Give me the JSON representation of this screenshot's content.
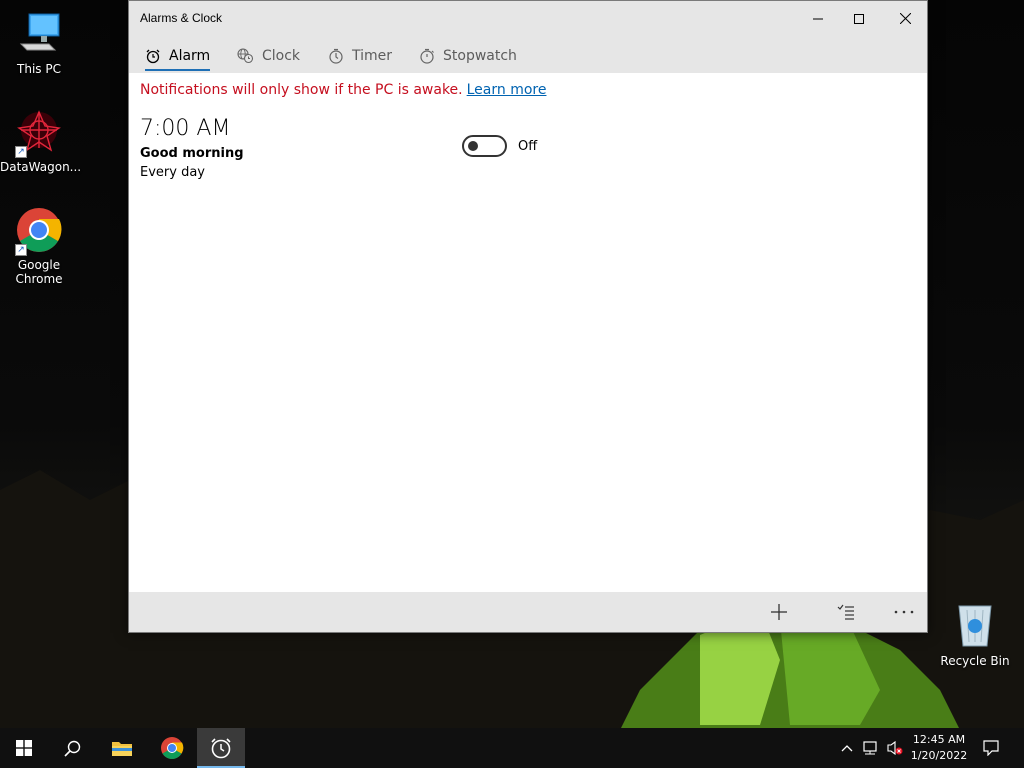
{
  "desktop": {
    "icons": [
      {
        "label": "This PC"
      },
      {
        "label": "DataWagon..."
      },
      {
        "label": "Google Chrome"
      },
      {
        "label": "Recycle Bin"
      }
    ]
  },
  "window": {
    "title": "Alarms & Clock",
    "tabs": [
      {
        "label": "Alarm",
        "icon": "alarm-clock-icon",
        "active": true
      },
      {
        "label": "Clock",
        "icon": "world-clock-icon"
      },
      {
        "label": "Timer",
        "icon": "timer-icon"
      },
      {
        "label": "Stopwatch",
        "icon": "stopwatch-icon"
      }
    ],
    "notice": {
      "text": "Notifications will only show if the PC is awake.",
      "link": "Learn more"
    },
    "alarm": {
      "time": "7:00 AM",
      "name": "Good morning",
      "repeat": "Every day",
      "state_label": "Off"
    },
    "command_bar": [
      "add-icon",
      "select-alarms-icon",
      "more-icon"
    ]
  },
  "taskbar": {
    "clock_time": "12:45 AM",
    "clock_date": "1/20/2022"
  },
  "colors": {
    "accent": "#1e6fb5",
    "notice": "#c50f1f",
    "link": "#0063b1",
    "chrome": "#e6e6e6"
  }
}
